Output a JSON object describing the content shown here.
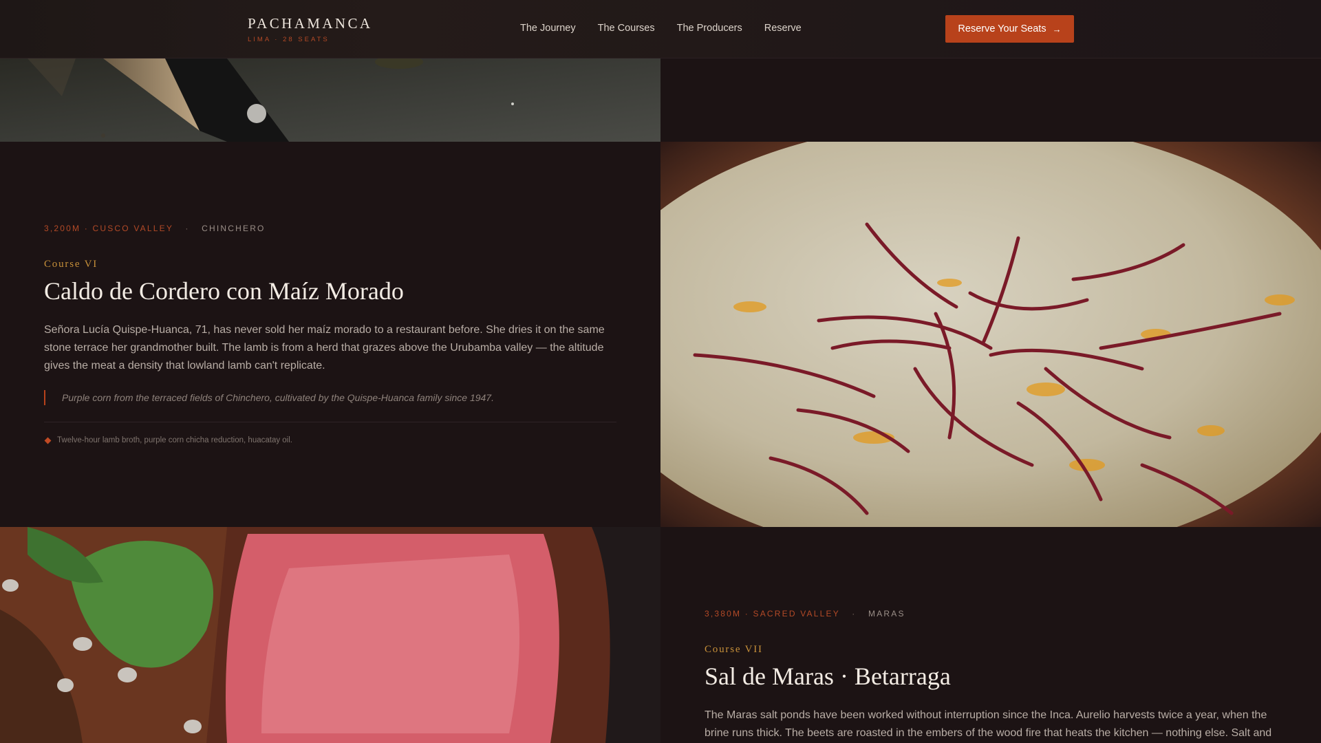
{
  "header": {
    "brand_name": "PACHAMANCA",
    "brand_sub": "LIMA · 28 SEATS",
    "nav": [
      {
        "label": "The Journey"
      },
      {
        "label": "The Courses"
      },
      {
        "label": "The Producers"
      },
      {
        "label": "Reserve"
      }
    ],
    "cta_label": "Reserve Your Seats",
    "cta_icon": "arrow-right-icon",
    "accent_color": "#b8421b"
  },
  "courses": [
    {
      "altitude_region": "3,200M · CUSCO VALLEY",
      "separator": "·",
      "place": "CHINCHERO",
      "course_label": "Course VI",
      "title": "Caldo de Cordero con Maíz Morado",
      "description": "Señora Lucía Quispe-Huanca, 71, has never sold her maíz morado to a restaurant before. She dries it on the same stone terrace her grandmother built. The lamb is from a herd that grazes above the Urubamba valley — the altitude gives the meat a density that lowland lamb can't replicate.",
      "quote": "Purple corn from the terraced fields of Chinchero, cultivated by the Quispe-Huanca family since 1947.",
      "note": "Twelve-hour lamb broth, purple corn chicha reduction, huacatay oil.",
      "image": "soup-bowl-photo"
    },
    {
      "altitude_region": "3,380M · SACRED VALLEY",
      "separator": "·",
      "place": "MARAS",
      "course_label": "Course VII",
      "title": "Sal de Maras · Betarraga",
      "description": "The Maras salt ponds have been worked without interruption since the Inca. Aurelio harvests twice a year, when the brine runs thick. The beets are roasted in the embers of the wood fire that heats the kitchen — nothing else. Salt and",
      "image": "sliced-beef-photo"
    }
  ],
  "top_tile_image": "knife-on-slate-photo"
}
